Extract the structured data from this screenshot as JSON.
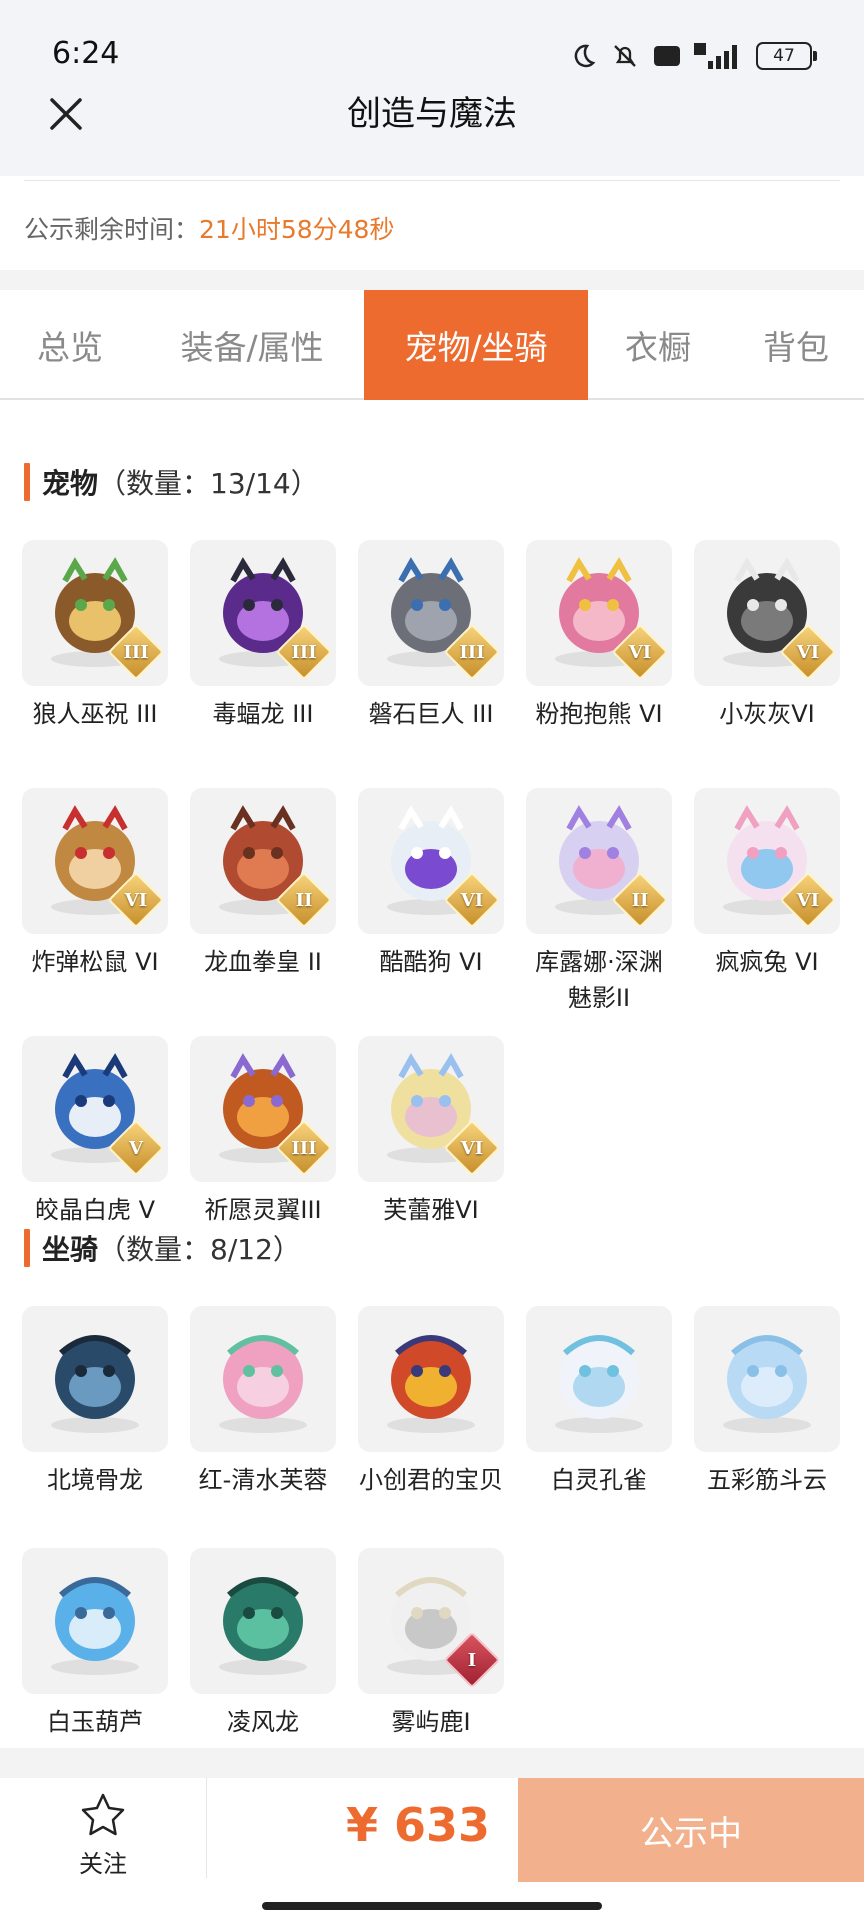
{
  "status_bar": {
    "time": "6:24",
    "network": "5G",
    "hd": "HD",
    "battery": "47"
  },
  "header": {
    "title": "创造与魔法"
  },
  "notice": {
    "label": "公示剩余时间：",
    "value": "21小时58分48秒"
  },
  "tabs": [
    {
      "label": "总览"
    },
    {
      "label": "装备/属性"
    },
    {
      "label": "宠物/坐骑"
    },
    {
      "label": "衣橱"
    },
    {
      "label": "背包"
    }
  ],
  "active_tab": "宠物/坐骑",
  "pets": {
    "title": "宠物",
    "count": "（数量：13/14）",
    "items": [
      {
        "name": "狼人巫祝 III",
        "badge": "III",
        "icon": "werewolf-shaman-icon"
      },
      {
        "name": "毒蝠龙 III",
        "badge": "III",
        "icon": "poison-bat-dragon-icon"
      },
      {
        "name": "磐石巨人 III",
        "badge": "III",
        "icon": "rock-giant-icon"
      },
      {
        "name": "粉抱抱熊 VI",
        "badge": "VI",
        "icon": "pink-hug-bear-icon"
      },
      {
        "name": "小灰灰VI",
        "badge": "VI",
        "icon": "grey-dog-icon"
      },
      {
        "name": "炸弹松鼠 VI",
        "badge": "VI",
        "icon": "bomb-squirrel-icon"
      },
      {
        "name": "龙血拳皇 II",
        "badge": "II",
        "icon": "dragon-blood-fist-icon"
      },
      {
        "name": "酷酷狗 VI",
        "badge": "VI",
        "icon": "cool-dog-icon"
      },
      {
        "name": "库露娜·深渊魅影II",
        "badge": "II",
        "icon": "kuluna-abyss-icon"
      },
      {
        "name": "疯疯兔 VI",
        "badge": "VI",
        "icon": "crazy-rabbit-icon"
      },
      {
        "name": "皎晶白虎 V",
        "badge": "V",
        "icon": "white-tiger-icon"
      },
      {
        "name": "祈愿灵翼III",
        "badge": "III",
        "icon": "wish-spirit-wing-icon"
      },
      {
        "name": "芙蕾雅VI",
        "badge": "VI",
        "icon": "freya-icon"
      }
    ]
  },
  "mounts": {
    "title": "坐骑",
    "count": "（数量：8/12）",
    "items": [
      {
        "name": "北境骨龙",
        "badge": "",
        "icon": "north-bone-dragon-icon"
      },
      {
        "name": "红-清水芙蓉",
        "badge": "",
        "icon": "red-lotus-icon"
      },
      {
        "name": "小创君的宝贝",
        "badge": "",
        "icon": "phoenix-bird-icon"
      },
      {
        "name": "白灵孔雀",
        "badge": "",
        "icon": "white-peacock-icon"
      },
      {
        "name": "五彩筋斗云",
        "badge": "",
        "icon": "colorful-cloud-icon"
      },
      {
        "name": "白玉葫芦",
        "badge": "",
        "icon": "white-jade-gourd-icon"
      },
      {
        "name": "凌风龙",
        "badge": "",
        "icon": "wind-dragon-icon"
      },
      {
        "name": "雾屿鹿I",
        "badge": "I",
        "icon": "mist-deer-icon"
      }
    ]
  },
  "bottom_bar": {
    "follow_label": "关注",
    "price": "¥ 633",
    "status_label": "公示中"
  },
  "colors": {
    "accent": "#ee6b2f",
    "status_button": "#f2b08c",
    "notice_time": "#e8792d",
    "badge_gold": "#d9a440",
    "badge_red": "#b9303e"
  }
}
